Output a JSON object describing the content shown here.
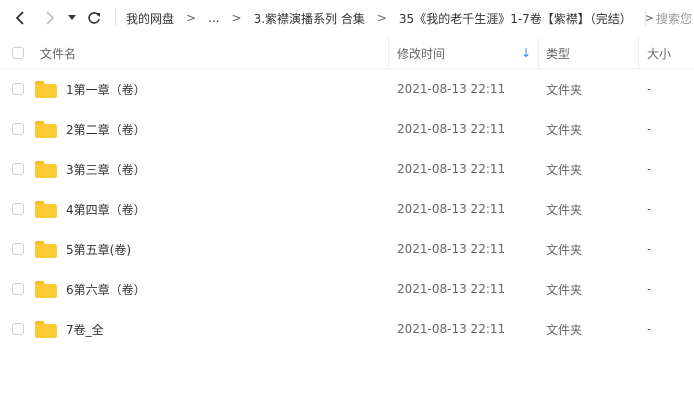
{
  "nav": {
    "back": "‹",
    "forward": "›",
    "dropdown": "▾",
    "refresh": "↻"
  },
  "breadcrumb": [
    {
      "label": "我的网盘"
    },
    {
      "label": "..."
    },
    {
      "label": "3.紫襟演播系列 合集"
    },
    {
      "label": "35《我的老千生涯》1-7卷【紫襟】（完结）"
    }
  ],
  "breadcrumb_separator": ">",
  "search": {
    "placeholder": "搜索您"
  },
  "columns": {
    "name": "文件名",
    "modified": "修改时间",
    "type": "类型",
    "size": "大小"
  },
  "sort_indicator": "↓",
  "files": [
    {
      "name": "1第一章（卷）",
      "modified": "2021-08-13 22:11",
      "type": "文件夹",
      "size": "-"
    },
    {
      "name": "2第二章（卷）",
      "modified": "2021-08-13 22:11",
      "type": "文件夹",
      "size": "-"
    },
    {
      "name": "3第三章（卷）",
      "modified": "2021-08-13 22:11",
      "type": "文件夹",
      "size": "-"
    },
    {
      "name": "4第四章（卷）",
      "modified": "2021-08-13 22:11",
      "type": "文件夹",
      "size": "-"
    },
    {
      "name": "5第五章(卷)",
      "modified": "2021-08-13 22:11",
      "type": "文件夹",
      "size": "-"
    },
    {
      "name": "6第六章（卷）",
      "modified": "2021-08-13 22:11",
      "type": "文件夹",
      "size": "-"
    },
    {
      "name": "7卷_全",
      "modified": "2021-08-13 22:11",
      "type": "文件夹",
      "size": "-"
    }
  ],
  "colors": {
    "folder": "#ffcb35",
    "sort_arrow": "#2a8af6"
  },
  "icons": {
    "folder": "folder-icon",
    "back": "back-arrow-icon",
    "forward": "forward-arrow-icon",
    "refresh": "refresh-icon"
  }
}
